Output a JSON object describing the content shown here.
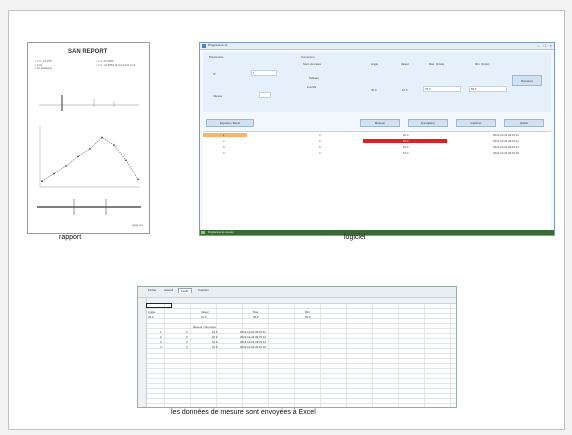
{
  "captions": {
    "report": "rapport",
    "software": "logiciel",
    "excel": "les données de mesure sont envoyées à Excel"
  },
  "colors": {
    "selected_row": "#f5b56a",
    "alarm_bar": "#e02020",
    "taskbar": "#3a6a34"
  },
  "report": {
    "title": "SAN REPORT",
    "info_left": [
      "• Y-1 : 21.075",
      "• 1:10",
      "• 10.10/ab/eg"
    ],
    "info_right": [
      "• Y-1: 47.9393",
      "• Y-1 : 11.6553 (3.0,4.0,5.0 mm)"
    ],
    "chart_data": {
      "type": "line",
      "x": [
        1,
        2,
        3,
        4,
        5,
        6,
        7,
        8,
        9
      ],
      "values": [
        2,
        6,
        10,
        15,
        19,
        25,
        21,
        13,
        3
      ],
      "ylim": [
        0,
        30
      ]
    },
    "page_number": "page 1/1"
  },
  "software": {
    "window_title": "Programme v1",
    "group1_label": "Paramètres",
    "field1_label": "N°",
    "field1_value": "1",
    "field2_label": "Vitesse",
    "group2_label": "Connexion",
    "radio1": "Sans données",
    "radio2": "Tableau",
    "radio3": "● Actifs",
    "col_headers": [
      "Angle",
      "Valeur",
      "Max. (limite)",
      "Min. (limite)"
    ],
    "values": [
      "45.0",
      "10.0"
    ],
    "inputs": [
      "35.0",
      "55.0"
    ],
    "start_button": "Démarrer",
    "buttons": [
      "Exporter / Excel",
      "Mesurer",
      "Enregistrer",
      "Imprimer",
      "Quitter"
    ],
    "table_rows": [
      {
        "no": "1",
        "ch": "3",
        "val": "10.0",
        "time": "2013-10-24 09:15:11"
      },
      {
        "no": "2",
        "ch": "3",
        "val": "10.0",
        "time": "2013-10-24 09:15:12"
      },
      {
        "no": "3",
        "ch": "3",
        "val": "10.0",
        "time": "2013-10-24 09:15:14"
      },
      {
        "no": "4",
        "ch": "3",
        "val": "10.0",
        "time": "2013-10-24 09:15:15"
      }
    ],
    "taskbar_text": "Programme de mesure"
  },
  "excel": {
    "tab_label": "Feuil1",
    "tabs": [
      "Fichier",
      "Accueil",
      "Insertion"
    ],
    "top_cells": [
      "Angle",
      "Valeur",
      "Max",
      "Min"
    ],
    "top_values": [
      "45.0",
      "10.0",
      "35.0",
      "55.0"
    ],
    "header_label": "Mesure / Données",
    "rows": [
      {
        "no": "1",
        "ch": "3",
        "val": "10.0",
        "time": "2013-10-24 09:15:11"
      },
      {
        "no": "2",
        "ch": "3",
        "val": "10.0",
        "time": "2013-10-24 09:15:12"
      },
      {
        "no": "3",
        "ch": "3",
        "val": "10.0",
        "time": "2013-10-24 09:15:14"
      },
      {
        "no": "4",
        "ch": "3",
        "val": "10.0",
        "time": "2013-10-24 09:15:15"
      }
    ]
  }
}
